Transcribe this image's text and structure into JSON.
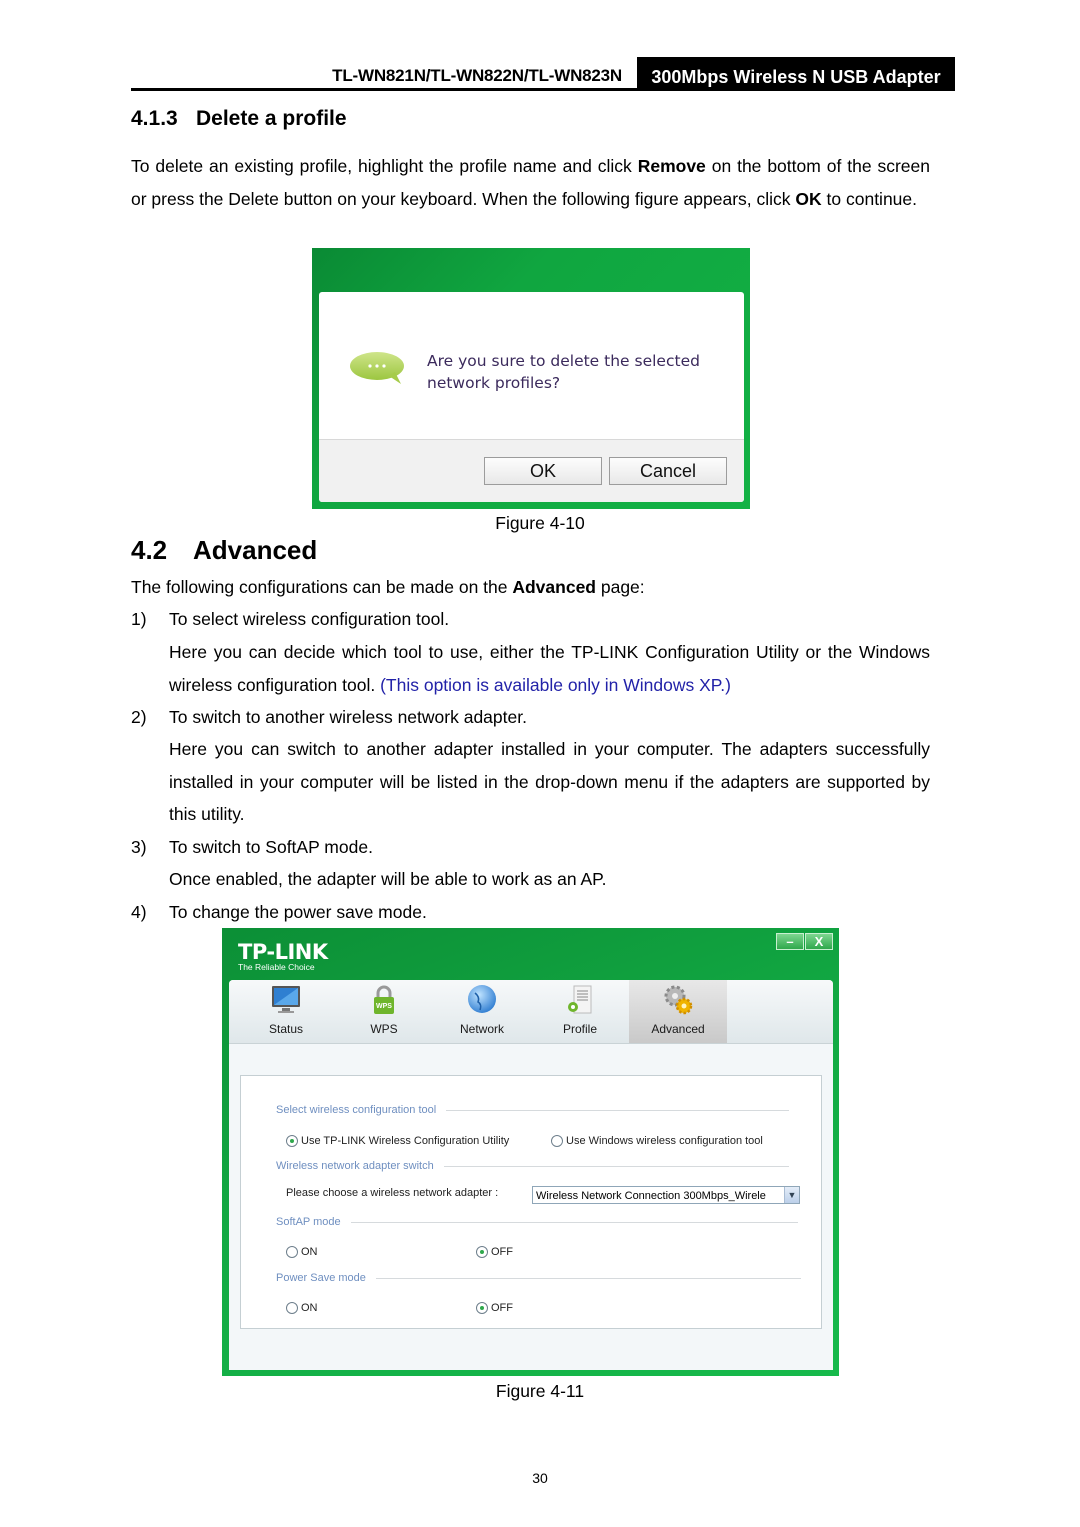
{
  "header": {
    "model": "TL-WN821N/TL-WN822N/TL-WN823N",
    "product": "300Mbps Wireless N USB Adapter"
  },
  "section_413": {
    "number": "4.1.3",
    "title": "Delete a profile",
    "para_parts": [
      "To delete an existing profile, highlight the profile name and click ",
      "Remove",
      " on the bottom of the screen or press the Delete button on your keyboard. When the following figure appears, click ",
      "OK",
      " to continue."
    ]
  },
  "figure_410": {
    "caption": "Figure 4-10",
    "icon": "chat-bubble-icon",
    "message": "Are you sure to delete the selected network profiles?",
    "ok_label": "OK",
    "cancel_label": "Cancel",
    "accent_color": "#13b245"
  },
  "section_42": {
    "number": "4.2",
    "title": "Advanced",
    "intro_parts": [
      "The following configurations can be made on the ",
      "Advanced",
      " page:"
    ],
    "items": [
      {
        "num": "1)",
        "title": "To select wireless configuration tool.",
        "desc": "Here you can decide which tool to use, either the TP-LINK Configuration Utility or the Windows wireless configuration tool.",
        "note": "(This option is available only in Windows XP.)"
      },
      {
        "num": "2)",
        "title": "To switch to another wireless network adapter.",
        "desc": "Here you can switch to another adapter installed in your computer. The adapters successfully installed in your computer will be listed in the drop-down menu if the adapters are supported by this utility."
      },
      {
        "num": "3)",
        "title": "To switch to SoftAP mode.",
        "desc": "Once enabled, the adapter will be able to work as an AP."
      },
      {
        "num": "4)",
        "title": "To change the power save mode."
      }
    ]
  },
  "figure_411": {
    "caption": "Figure 4-11",
    "logo": "TP-LINK",
    "logo_tagline": "The Reliable Choice",
    "window_buttons": {
      "minimize": "–",
      "close": "X"
    },
    "tabs": [
      {
        "label": "Status",
        "icon": "monitor-icon",
        "active": false
      },
      {
        "label": "WPS",
        "icon": "wps-lock-icon",
        "active": false
      },
      {
        "label": "Network",
        "icon": "globe-icon",
        "active": false
      },
      {
        "label": "Profile",
        "icon": "profile-document-icon",
        "active": false
      },
      {
        "label": "Advanced",
        "icon": "gears-icon",
        "active": true
      }
    ],
    "sections": {
      "config_tool": {
        "title": "Select wireless configuration tool",
        "options": [
          {
            "label": "Use TP-LINK Wireless Configuration Utility",
            "selected": true
          },
          {
            "label": "Use Windows wireless configuration tool",
            "selected": false
          }
        ]
      },
      "adapter_switch": {
        "title": "Wireless network adapter switch",
        "prompt": "Please choose a wireless network adapter :",
        "selected_value": "Wireless Network Connection   300Mbps_Wirele"
      },
      "softap": {
        "title": "SoftAP mode",
        "options": [
          {
            "label": "ON",
            "selected": false
          },
          {
            "label": "OFF",
            "selected": true
          }
        ]
      },
      "power_save": {
        "title": "Power Save mode",
        "options": [
          {
            "label": "ON",
            "selected": false
          },
          {
            "label": "OFF",
            "selected": true
          }
        ]
      }
    }
  },
  "page_number": "30"
}
